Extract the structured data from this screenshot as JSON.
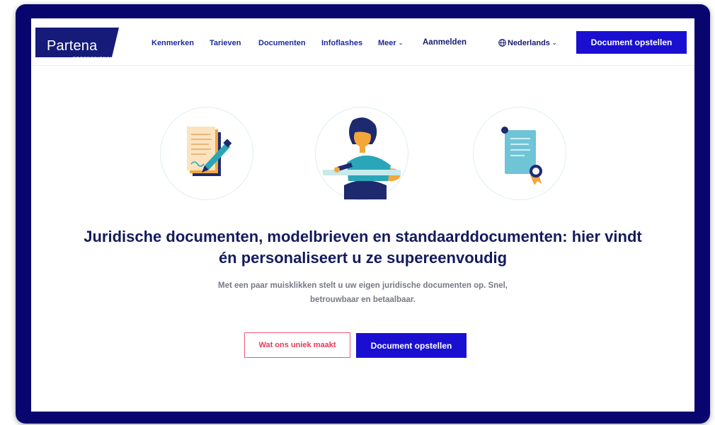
{
  "brand": {
    "name": "Partena",
    "sub": "PROFESSIONAL",
    "color": "#161b7a"
  },
  "nav": {
    "items": [
      {
        "label": "Kenmerken"
      },
      {
        "label": "Tarieven"
      },
      {
        "label": "Documenten"
      },
      {
        "label": "Infoflashes"
      },
      {
        "label": "Meer"
      }
    ],
    "login": "Aanmelden",
    "language": "Nederlands",
    "cta": "Document opstellen"
  },
  "icons": {
    "signing": "document-signing-icon",
    "person": "person-writing-icon",
    "certificate": "certificate-icon",
    "globe": "globe-icon",
    "chevron": "chevron-down-icon"
  },
  "hero": {
    "title_line1": "Juridische documenten, modelbrieven en standaarddocumenten: hier vindt",
    "title_line2": "én personaliseert u ze supereenvoudig",
    "subtitle_line1": "Met een paar muisklikken stelt u uw eigen juridische documenten op. Snel,",
    "subtitle_line2": "betrouwbaar en betaalbaar.",
    "secondary_button": "Wat ons uniek maakt",
    "primary_button": "Document opstellen"
  },
  "colors": {
    "frame": "#08066e",
    "primary": "#1a0fd1",
    "accent_pink": "#e8385d",
    "heading": "#141b5c",
    "muted": "#767a87"
  }
}
